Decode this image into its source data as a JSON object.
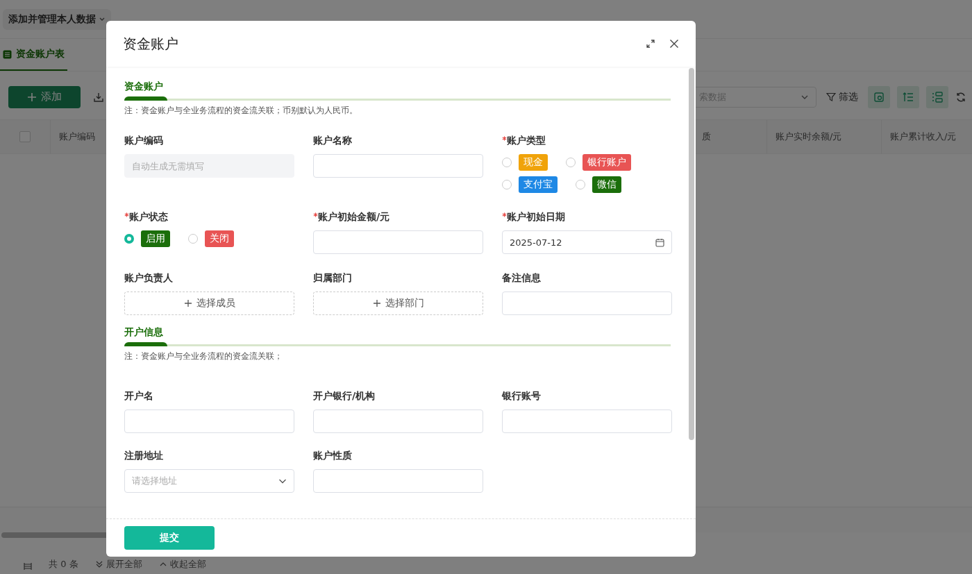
{
  "page": {
    "breadcrumb": "添加并管理本人数据",
    "tabs": [
      {
        "label": "资金账户表",
        "selected": true
      }
    ],
    "toolbar": {
      "add_button": "添加",
      "search_placeholder": "索数据",
      "filter": "筛选"
    },
    "table": {
      "select_all_checked": false,
      "columns": [
        "账户编码",
        "质",
        "账户实时余额/元",
        "账户累计收入/元"
      ]
    },
    "footer": {
      "count": "共 0 条",
      "expand_all": "展开全部",
      "collapse_all": "收起全部"
    }
  },
  "dialog": {
    "title": "资金账户",
    "submit": "提交",
    "sections": [
      {
        "title": "资金账户",
        "note": "注：资金账户与全业务流程的资金流关联；币别默认为人民币。",
        "fields": [
          {
            "kind": "text",
            "label": "账户编码",
            "required": false,
            "placeholder": "自动生成无需填写",
            "disabled": true
          },
          {
            "kind": "text",
            "label": "账户名称",
            "required": false,
            "disabled": false
          },
          {
            "kind": "radio",
            "label": "账户类型",
            "required": true,
            "options": [
              {
                "label": "现金",
                "color": "#f0a30a",
                "selected": false
              },
              {
                "label": "银行账户",
                "color": "#e85454",
                "selected": false
              },
              {
                "label": "支付宝",
                "color": "#1e88e5",
                "selected": false
              },
              {
                "label": "微信",
                "color": "#1b6e0b",
                "selected": false
              }
            ]
          },
          {
            "kind": "radio",
            "label": "账户状态",
            "required": true,
            "options": [
              {
                "label": "启用",
                "color": "#1b6e0b",
                "selected": true
              },
              {
                "label": "关闭",
                "color": "#e85454",
                "selected": false
              }
            ]
          },
          {
            "kind": "text",
            "label": "账户初始金额/元",
            "required": true,
            "disabled": false
          },
          {
            "kind": "date",
            "label": "账户初始日期",
            "required": true,
            "value": "2025-07-12"
          },
          {
            "kind": "picker",
            "label": "账户负责人",
            "required": false,
            "button": "选择成员"
          },
          {
            "kind": "picker",
            "label": "归属部门",
            "required": false,
            "button": "选择部门"
          },
          {
            "kind": "text",
            "label": "备注信息",
            "required": false,
            "disabled": false
          }
        ]
      },
      {
        "title": "开户信息",
        "note": "注：资金账户与全业务流程的资金流关联；",
        "fields": [
          {
            "kind": "text",
            "label": "开户名",
            "required": false,
            "disabled": false
          },
          {
            "kind": "text",
            "label": "开户银行/机构",
            "required": false,
            "disabled": false
          },
          {
            "kind": "text",
            "label": "银行账号",
            "required": false,
            "disabled": false
          },
          {
            "kind": "select",
            "label": "注册地址",
            "required": false,
            "placeholder": "请选择地址"
          },
          {
            "kind": "text",
            "label": "账户性质",
            "required": false,
            "disabled": false
          }
        ]
      }
    ]
  }
}
